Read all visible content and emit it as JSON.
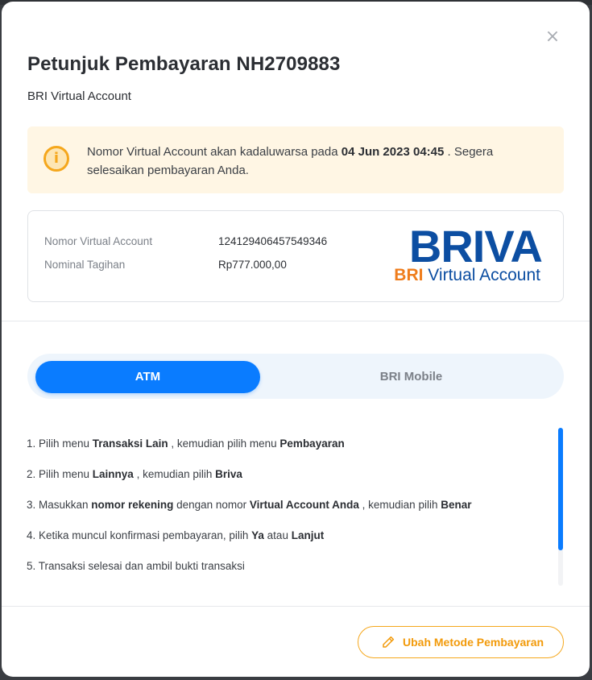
{
  "modal": {
    "close_glyph": "×",
    "title": "Petunjuk Pembayaran NH2709883",
    "subtitle": "BRI Virtual Account"
  },
  "notice": {
    "icon": "info-icon",
    "text_before": "Nomor Virtual Account akan kadaluwarsa pada ",
    "expiry": "04 Jun 2023 04:45",
    "text_after": " . Segera selesaikan pembayaran Anda.",
    "accent_color": "#f5a71c",
    "background_color": "#fff6e4"
  },
  "account": {
    "va_label": "Nomor Virtual Account",
    "va_number": "124129406457549346",
    "amount_label": "Nominal Tagihan",
    "amount_value": "Rp777.000,00"
  },
  "logo": {
    "word": "BRIVA",
    "sub_bri": "BRI",
    "sub_rest": " Virtual Account",
    "brand_blue": "#0c4ea2",
    "brand_orange": "#ef7d1c"
  },
  "tabs": [
    {
      "label": "ATM",
      "active": true
    },
    {
      "label": "BRI Mobile",
      "active": false
    }
  ],
  "steps": [
    {
      "parts": [
        [
          "1. Pilih menu ",
          false
        ],
        [
          "Transaksi Lain",
          true
        ],
        [
          " , kemudian pilih menu ",
          false
        ],
        [
          "Pembayaran",
          true
        ]
      ]
    },
    {
      "parts": [
        [
          "2. Pilih menu ",
          false
        ],
        [
          "Lainnya",
          true
        ],
        [
          " , kemudian pilih ",
          false
        ],
        [
          "Briva",
          true
        ]
      ]
    },
    {
      "parts": [
        [
          "3. Masukkan ",
          false
        ],
        [
          "nomor rekening",
          true
        ],
        [
          " dengan nomor ",
          false
        ],
        [
          "Virtual Account Anda",
          true
        ],
        [
          " , kemudian pilih ",
          false
        ],
        [
          "Benar",
          true
        ]
      ]
    },
    {
      "parts": [
        [
          "4. Ketika muncul konfirmasi pembayaran, pilih ",
          false
        ],
        [
          "Ya",
          true
        ],
        [
          " atau ",
          false
        ],
        [
          "Lanjut",
          true
        ]
      ]
    },
    {
      "parts": [
        [
          "5. Transaksi selesai dan ambil bukti transaksi",
          false
        ]
      ]
    }
  ],
  "footer": {
    "change_button_label": "Ubah Metode Pembayaran",
    "change_button_icon": "pencil-icon",
    "accent_color": "#f5a71c"
  },
  "theme": {
    "primary": "#0a7cff"
  }
}
